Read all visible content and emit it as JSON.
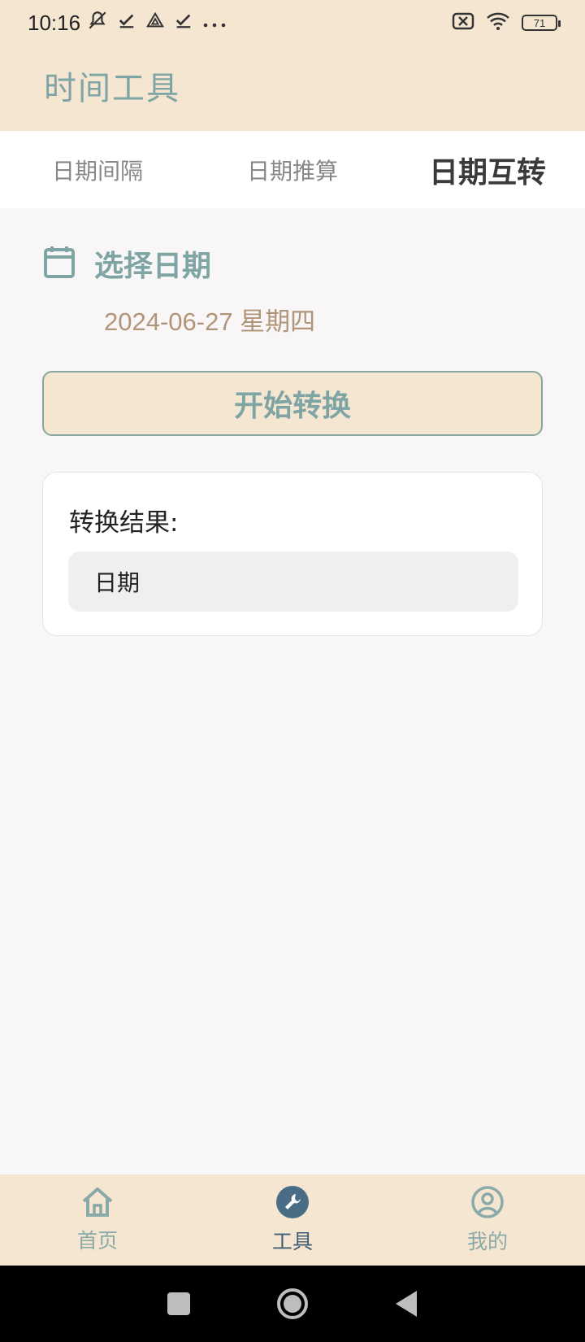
{
  "status_bar": {
    "time": "10:16",
    "left_icons": [
      "muted-bell-icon",
      "check-icon",
      "drive-icon",
      "check-icon",
      "more-dots-icon"
    ],
    "right_icons": [
      "sim-off-icon",
      "wifi-icon",
      "battery-icon"
    ],
    "battery_level": "71"
  },
  "header": {
    "title": "时间工具"
  },
  "tabs": [
    {
      "label": "日期间隔",
      "active": false
    },
    {
      "label": "日期推算",
      "active": false
    },
    {
      "label": "日期互转",
      "active": true
    }
  ],
  "date_select": {
    "icon": "calendar-icon",
    "title": "选择日期",
    "value": "2024-06-27 星期四"
  },
  "convert_button": {
    "label": "开始转换"
  },
  "result": {
    "label": "转换结果:",
    "value": "日期"
  },
  "bottom_nav": [
    {
      "label": "首页",
      "icon": "home-icon",
      "active": false
    },
    {
      "label": "工具",
      "icon": "wrench-icon",
      "active": true
    },
    {
      "label": "我的",
      "icon": "user-circle-icon",
      "active": false
    }
  ],
  "system_nav": {
    "buttons": [
      "recents-square-icon",
      "home-circle-icon",
      "back-triangle-icon"
    ]
  },
  "colors": {
    "header_bg": "#f5e6d2",
    "accent_teal": "#7fa4a4",
    "date_value": "#b0957a",
    "active_nav": "#3f5d75"
  }
}
